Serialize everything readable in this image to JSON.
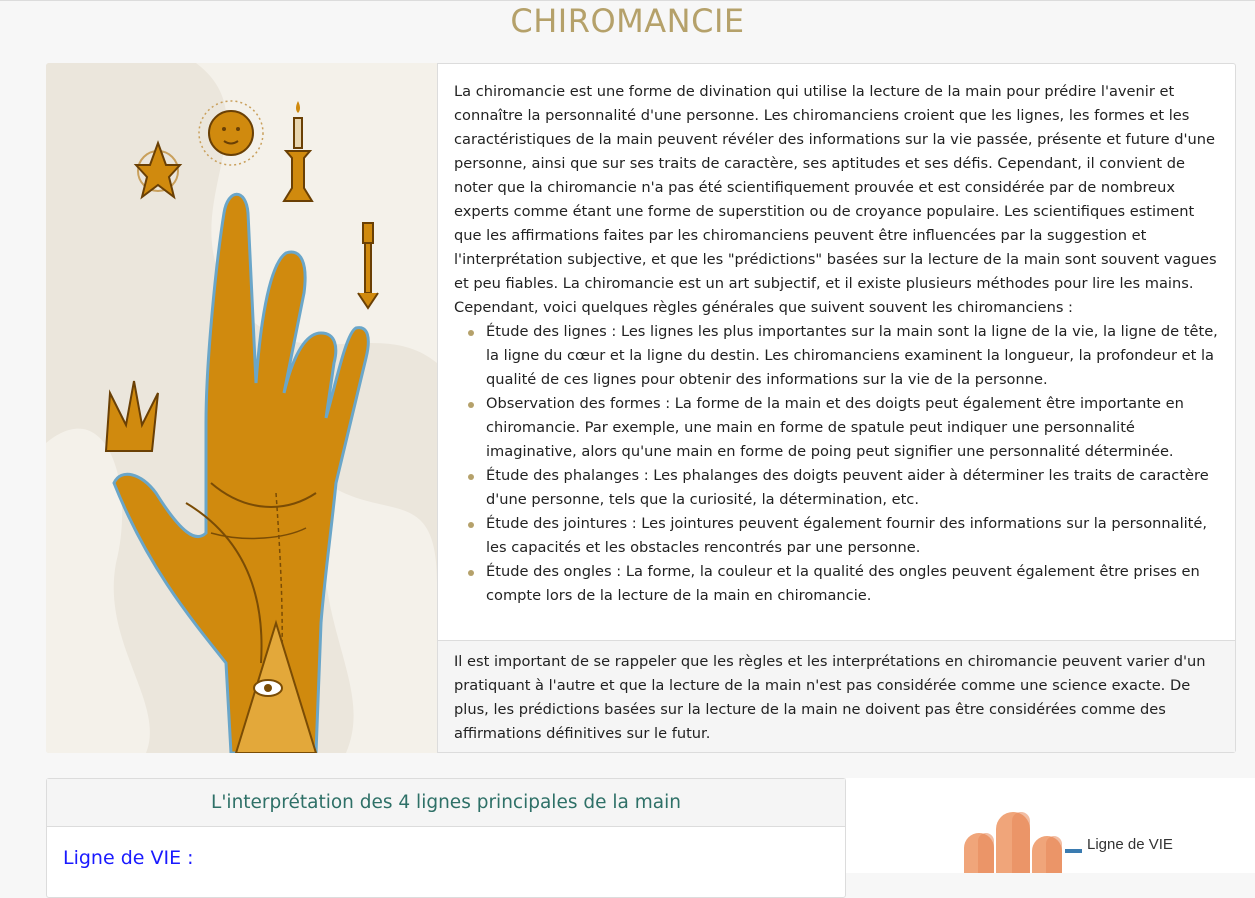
{
  "page": {
    "title": "CHIROMANCIE"
  },
  "hero": {
    "image_alt": "Illustration d'une main de chiromancie avec symboles",
    "intro": "La chiromancie est une forme de divination qui utilise la lecture de la main pour prédire l'avenir et connaître la personnalité d'une personne. Les chiromanciens croient que les lignes, les formes et les caractéristiques de la main peuvent révéler des informations sur la vie passée, présente et future d'une personne, ainsi que sur ses traits de caractère, ses aptitudes et ses défis. Cependant, il convient de noter que la chiromancie n'a pas été scientifiquement prouvée et est considérée par de nombreux experts comme étant une forme de superstition ou de croyance populaire. Les scientifiques estiment que les affirmations faites par les chiromanciens peuvent être influencées par la suggestion et l'interprétation subjective, et que les \"prédictions\" basées sur la lecture de la main sont souvent vagues et peu fiables. La chiromancie est un art subjectif, et il existe plusieurs méthodes pour lire les mains. Cependant, voici quelques règles générales que suivent souvent les chiromanciens :",
    "rules": [
      "Étude des lignes : Les lignes les plus importantes sur la main sont la ligne de la vie, la ligne de tête, la ligne du cœur et la ligne du destin. Les chiromanciens examinent la longueur, la profondeur et la qualité de ces lignes pour obtenir des informations sur la vie de la personne.",
      "Observation des formes : La forme de la main et des doigts peut également être importante en chiromancie. Par exemple, une main en forme de spatule peut indiquer une personnalité imaginative, alors qu'une main en forme de poing peut signifier une personnalité déterminée.",
      "Étude des phalanges : Les phalanges des doigts peuvent aider à déterminer les traits de caractère d'une personne, tels que la curiosité, la détermination, etc.",
      "Étude des jointures : Les jointures peuvent également fournir des informations sur la personnalité, les capacités et les obstacles rencontrés par une personne.",
      "Étude des ongles : La forme, la couleur et la qualité des ongles peuvent également être prises en compte lors de la lecture de la main en chiromancie."
    ],
    "footer": "Il est important de se rappeler que les règles et les interprétations en chiromancie peuvent varier d'un pratiquant à l'autre et que la lecture de la main n'est pas considérée comme une science exacte. De plus, les prédictions basées sur la lecture de la main ne doivent pas être considérées comme des affirmations définitives sur le futur."
  },
  "lines_section": {
    "header": "L'interprétation des 4 lignes principales de la main",
    "first_line_title": "Ligne de VIE :",
    "illustration_label": "Ligne de VIE"
  },
  "colors": {
    "title_gold": "#b5a16a",
    "hand_orange": "#d08a0e",
    "header_teal": "#2e7067",
    "link_blue": "#1a1aff"
  }
}
